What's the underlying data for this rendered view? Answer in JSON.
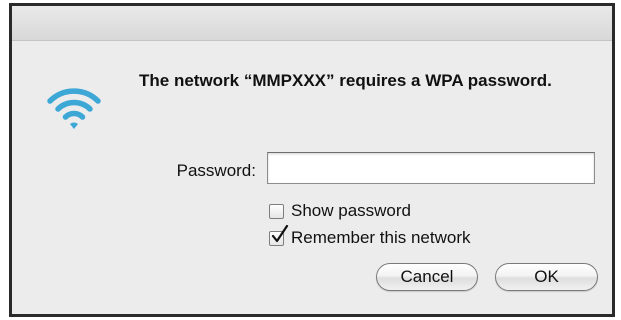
{
  "dialog": {
    "message": "The network “MMPXXX” requires a WPA password.",
    "icon": "wifi-icon"
  },
  "password": {
    "label": "Password:",
    "value": "",
    "placeholder": ""
  },
  "options": {
    "show_password": {
      "label": "Show password",
      "checked": false
    },
    "remember_network": {
      "label": "Remember this network",
      "checked": true
    }
  },
  "buttons": {
    "cancel": "Cancel",
    "ok": "OK"
  },
  "colors": {
    "wifi": "#3da7d6",
    "dialog_background": "#ececec"
  }
}
